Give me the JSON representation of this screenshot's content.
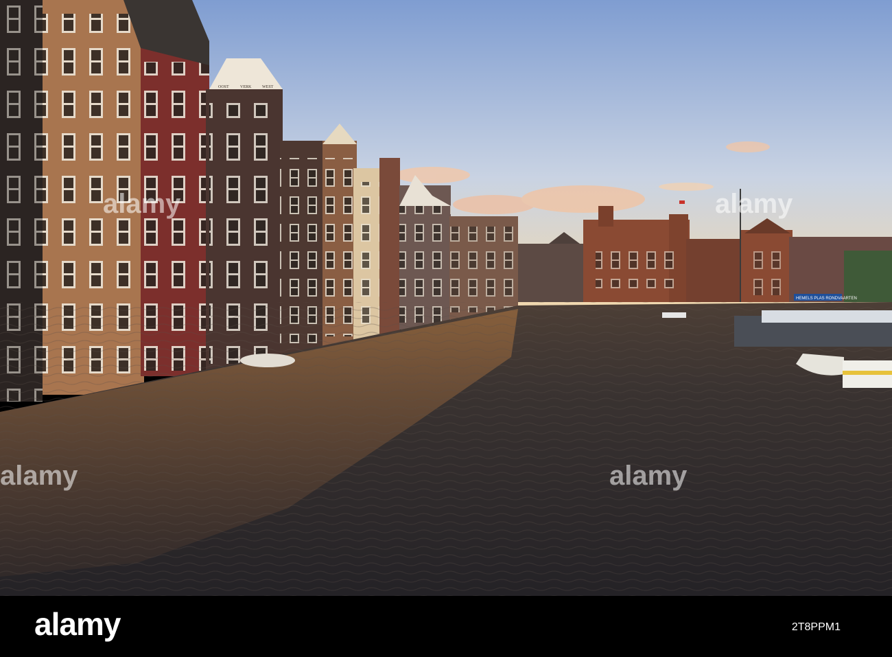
{
  "photo": {
    "subject": "canal-with-historic-buildings",
    "colors": {
      "sky_top": "#7f9dd1",
      "sky_bottom": "#f6d9a8",
      "water": "#2d2a2c",
      "brick": "#8a4a33"
    }
  },
  "house_signs": {
    "left": "OOST",
    "middle": "VERK",
    "right": "WEST"
  },
  "boat_banner": "HEMELS PLAS RONDVAARTEN",
  "watermark": {
    "text": "alamy",
    "left": "alamy",
    "center": "alamy",
    "right": "alamy"
  },
  "footer": {
    "brand": "alamy",
    "image_id": "2T8PPM1"
  }
}
